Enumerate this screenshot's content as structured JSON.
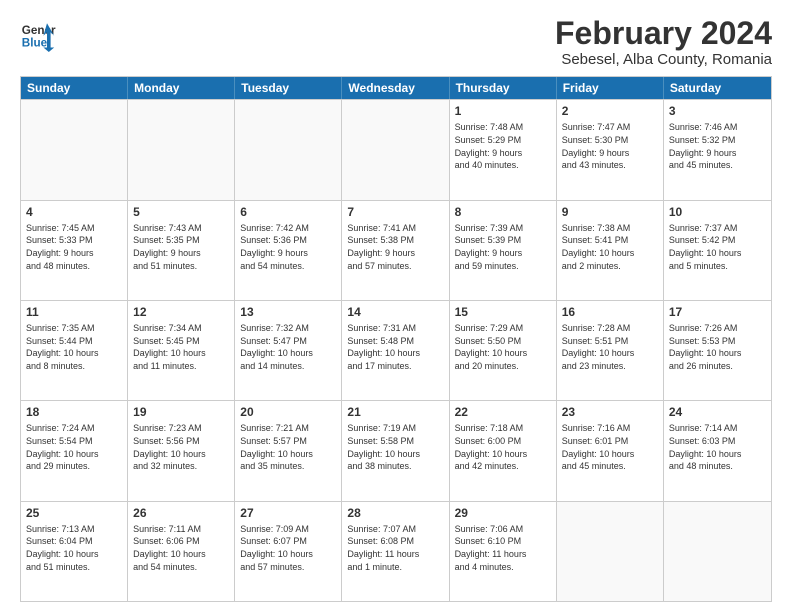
{
  "header": {
    "logo_line1": "General",
    "logo_line2": "Blue",
    "title": "February 2024",
    "subtitle": "Sebesel, Alba County, Romania"
  },
  "days": [
    "Sunday",
    "Monday",
    "Tuesday",
    "Wednesday",
    "Thursday",
    "Friday",
    "Saturday"
  ],
  "weeks": [
    [
      {
        "day": "",
        "empty": true
      },
      {
        "day": "",
        "empty": true
      },
      {
        "day": "",
        "empty": true
      },
      {
        "day": "",
        "empty": true
      },
      {
        "day": "1",
        "line1": "Sunrise: 7:48 AM",
        "line2": "Sunset: 5:29 PM",
        "line3": "Daylight: 9 hours",
        "line4": "and 40 minutes."
      },
      {
        "day": "2",
        "line1": "Sunrise: 7:47 AM",
        "line2": "Sunset: 5:30 PM",
        "line3": "Daylight: 9 hours",
        "line4": "and 43 minutes."
      },
      {
        "day": "3",
        "line1": "Sunrise: 7:46 AM",
        "line2": "Sunset: 5:32 PM",
        "line3": "Daylight: 9 hours",
        "line4": "and 45 minutes."
      }
    ],
    [
      {
        "day": "4",
        "line1": "Sunrise: 7:45 AM",
        "line2": "Sunset: 5:33 PM",
        "line3": "Daylight: 9 hours",
        "line4": "and 48 minutes."
      },
      {
        "day": "5",
        "line1": "Sunrise: 7:43 AM",
        "line2": "Sunset: 5:35 PM",
        "line3": "Daylight: 9 hours",
        "line4": "and 51 minutes."
      },
      {
        "day": "6",
        "line1": "Sunrise: 7:42 AM",
        "line2": "Sunset: 5:36 PM",
        "line3": "Daylight: 9 hours",
        "line4": "and 54 minutes."
      },
      {
        "day": "7",
        "line1": "Sunrise: 7:41 AM",
        "line2": "Sunset: 5:38 PM",
        "line3": "Daylight: 9 hours",
        "line4": "and 57 minutes."
      },
      {
        "day": "8",
        "line1": "Sunrise: 7:39 AM",
        "line2": "Sunset: 5:39 PM",
        "line3": "Daylight: 9 hours",
        "line4": "and 59 minutes."
      },
      {
        "day": "9",
        "line1": "Sunrise: 7:38 AM",
        "line2": "Sunset: 5:41 PM",
        "line3": "Daylight: 10 hours",
        "line4": "and 2 minutes."
      },
      {
        "day": "10",
        "line1": "Sunrise: 7:37 AM",
        "line2": "Sunset: 5:42 PM",
        "line3": "Daylight: 10 hours",
        "line4": "and 5 minutes."
      }
    ],
    [
      {
        "day": "11",
        "line1": "Sunrise: 7:35 AM",
        "line2": "Sunset: 5:44 PM",
        "line3": "Daylight: 10 hours",
        "line4": "and 8 minutes."
      },
      {
        "day": "12",
        "line1": "Sunrise: 7:34 AM",
        "line2": "Sunset: 5:45 PM",
        "line3": "Daylight: 10 hours",
        "line4": "and 11 minutes."
      },
      {
        "day": "13",
        "line1": "Sunrise: 7:32 AM",
        "line2": "Sunset: 5:47 PM",
        "line3": "Daylight: 10 hours",
        "line4": "and 14 minutes."
      },
      {
        "day": "14",
        "line1": "Sunrise: 7:31 AM",
        "line2": "Sunset: 5:48 PM",
        "line3": "Daylight: 10 hours",
        "line4": "and 17 minutes."
      },
      {
        "day": "15",
        "line1": "Sunrise: 7:29 AM",
        "line2": "Sunset: 5:50 PM",
        "line3": "Daylight: 10 hours",
        "line4": "and 20 minutes."
      },
      {
        "day": "16",
        "line1": "Sunrise: 7:28 AM",
        "line2": "Sunset: 5:51 PM",
        "line3": "Daylight: 10 hours",
        "line4": "and 23 minutes."
      },
      {
        "day": "17",
        "line1": "Sunrise: 7:26 AM",
        "line2": "Sunset: 5:53 PM",
        "line3": "Daylight: 10 hours",
        "line4": "and 26 minutes."
      }
    ],
    [
      {
        "day": "18",
        "line1": "Sunrise: 7:24 AM",
        "line2": "Sunset: 5:54 PM",
        "line3": "Daylight: 10 hours",
        "line4": "and 29 minutes."
      },
      {
        "day": "19",
        "line1": "Sunrise: 7:23 AM",
        "line2": "Sunset: 5:56 PM",
        "line3": "Daylight: 10 hours",
        "line4": "and 32 minutes."
      },
      {
        "day": "20",
        "line1": "Sunrise: 7:21 AM",
        "line2": "Sunset: 5:57 PM",
        "line3": "Daylight: 10 hours",
        "line4": "and 35 minutes."
      },
      {
        "day": "21",
        "line1": "Sunrise: 7:19 AM",
        "line2": "Sunset: 5:58 PM",
        "line3": "Daylight: 10 hours",
        "line4": "and 38 minutes."
      },
      {
        "day": "22",
        "line1": "Sunrise: 7:18 AM",
        "line2": "Sunset: 6:00 PM",
        "line3": "Daylight: 10 hours",
        "line4": "and 42 minutes."
      },
      {
        "day": "23",
        "line1": "Sunrise: 7:16 AM",
        "line2": "Sunset: 6:01 PM",
        "line3": "Daylight: 10 hours",
        "line4": "and 45 minutes."
      },
      {
        "day": "24",
        "line1": "Sunrise: 7:14 AM",
        "line2": "Sunset: 6:03 PM",
        "line3": "Daylight: 10 hours",
        "line4": "and 48 minutes."
      }
    ],
    [
      {
        "day": "25",
        "line1": "Sunrise: 7:13 AM",
        "line2": "Sunset: 6:04 PM",
        "line3": "Daylight: 10 hours",
        "line4": "and 51 minutes."
      },
      {
        "day": "26",
        "line1": "Sunrise: 7:11 AM",
        "line2": "Sunset: 6:06 PM",
        "line3": "Daylight: 10 hours",
        "line4": "and 54 minutes."
      },
      {
        "day": "27",
        "line1": "Sunrise: 7:09 AM",
        "line2": "Sunset: 6:07 PM",
        "line3": "Daylight: 10 hours",
        "line4": "and 57 minutes."
      },
      {
        "day": "28",
        "line1": "Sunrise: 7:07 AM",
        "line2": "Sunset: 6:08 PM",
        "line3": "Daylight: 11 hours",
        "line4": "and 1 minute."
      },
      {
        "day": "29",
        "line1": "Sunrise: 7:06 AM",
        "line2": "Sunset: 6:10 PM",
        "line3": "Daylight: 11 hours",
        "line4": "and 4 minutes."
      },
      {
        "day": "",
        "empty": true
      },
      {
        "day": "",
        "empty": true
      }
    ]
  ]
}
